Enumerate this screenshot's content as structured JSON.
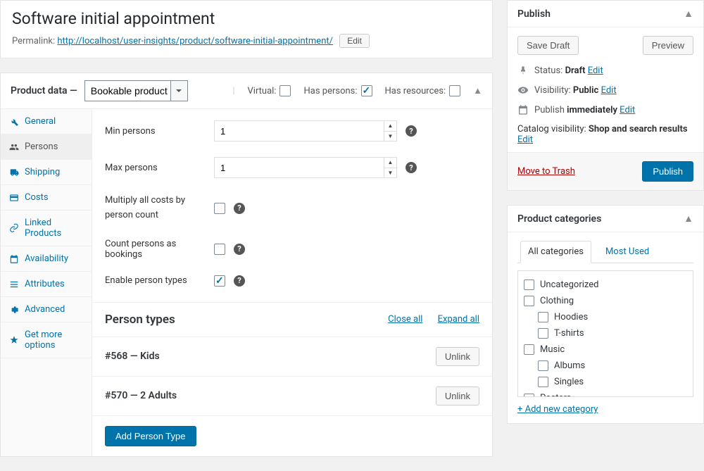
{
  "title": "Software initial appointment",
  "permalink": {
    "label": "Permalink:",
    "base": "http://localhost/user-insights/product/",
    "slug": "software-initial-appointment/",
    "edit": "Edit"
  },
  "product_data": {
    "label": "Product data —",
    "type": "Bookable product",
    "virtual_label": "Virtual:",
    "persons_label": "Has persons:",
    "resources_label": "Has resources:"
  },
  "tabs": {
    "general": "General",
    "persons": "Persons",
    "shipping": "Shipping",
    "costs": "Costs",
    "linked": "Linked Products",
    "availability": "Availability",
    "attributes": "Attributes",
    "advanced": "Advanced",
    "more": "Get more options"
  },
  "fields": {
    "min_persons_label": "Min persons",
    "min_persons_value": "1",
    "max_persons_label": "Max persons",
    "max_persons_value": "1",
    "multiply_label": "Multiply all costs by person count",
    "count_bookings_label": "Count persons as bookings",
    "enable_types_label": "Enable person types"
  },
  "person_types": {
    "heading": "Person types",
    "close_all": "Close all",
    "expand_all": "Expand all",
    "items": [
      {
        "id": "#568",
        "dash": " — ",
        "name": "Kids"
      },
      {
        "id": "#570",
        "dash": " — ",
        "name": "2 Adults"
      }
    ],
    "unlink": "Unlink",
    "add": "Add Person Type"
  },
  "publish": {
    "title": "Publish",
    "save_draft": "Save Draft",
    "preview": "Preview",
    "status_label": "Status:",
    "status_value": "Draft",
    "visibility_label": "Visibility:",
    "visibility_value": "Public",
    "publish_label": "Publish",
    "publish_value": "immediately",
    "edit": "Edit",
    "catalog_label": "Catalog visibility:",
    "catalog_value": "Shop and search results",
    "trash": "Move to Trash",
    "submit": "Publish"
  },
  "categories": {
    "title": "Product categories",
    "tab_all": "All categories",
    "tab_most": "Most Used",
    "items": [
      {
        "label": "Uncategorized",
        "child": false
      },
      {
        "label": "Clothing",
        "child": false
      },
      {
        "label": "Hoodies",
        "child": true
      },
      {
        "label": "T-shirts",
        "child": true
      },
      {
        "label": "Music",
        "child": false
      },
      {
        "label": "Albums",
        "child": true
      },
      {
        "label": "Singles",
        "child": true
      },
      {
        "label": "Posters",
        "child": false
      }
    ],
    "add": "+ Add new category"
  }
}
